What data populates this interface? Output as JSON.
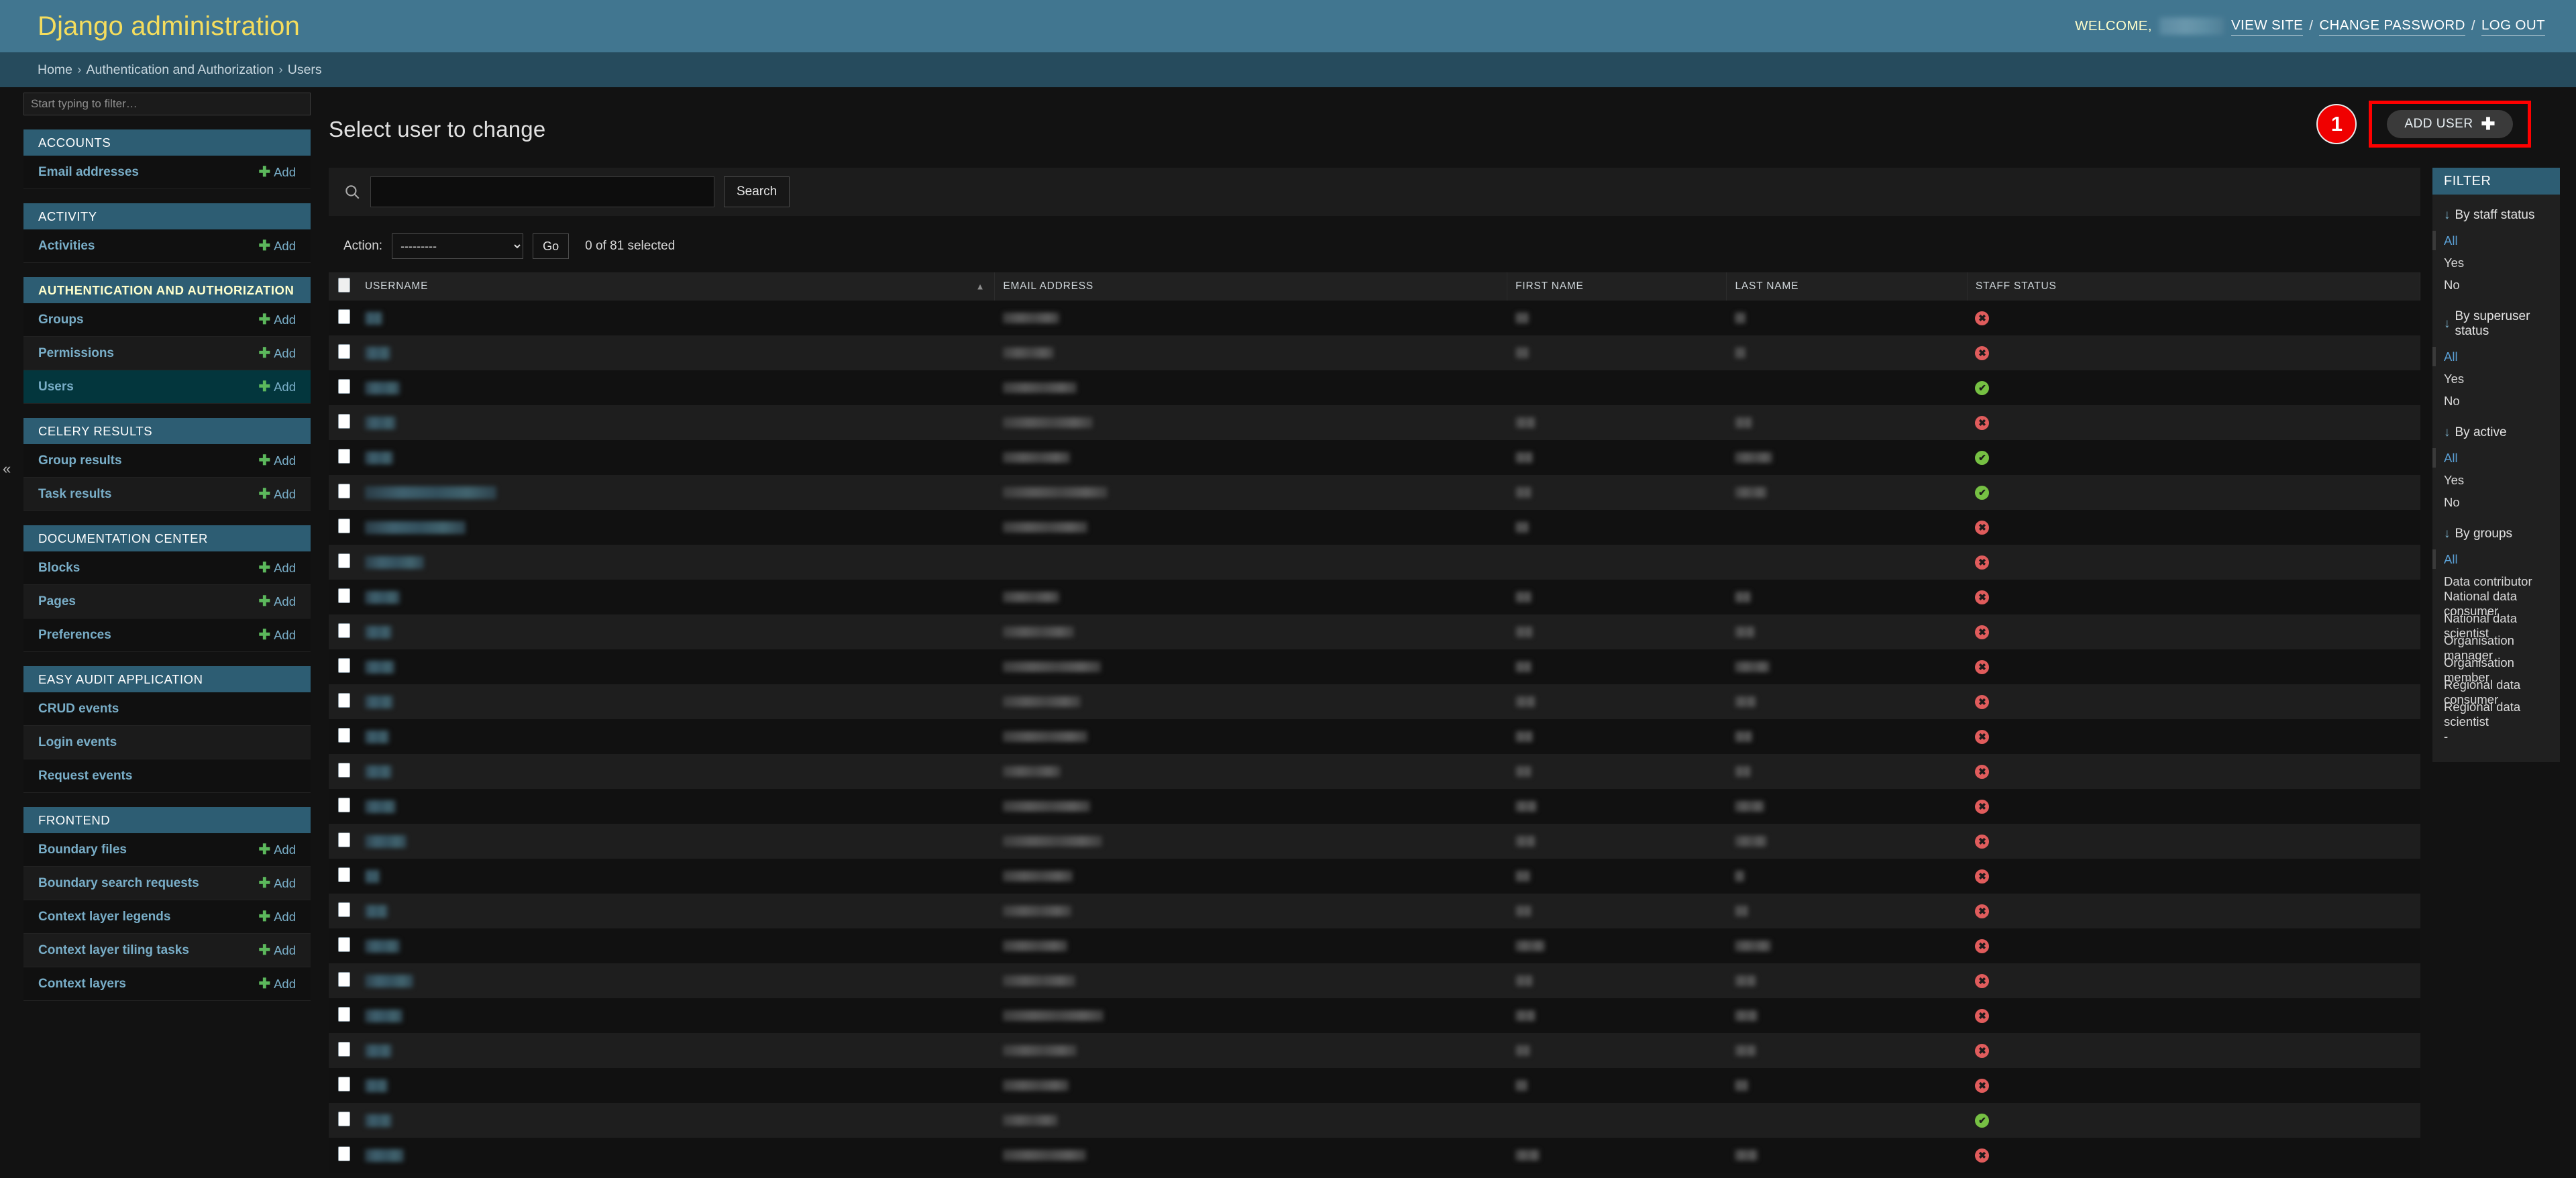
{
  "header": {
    "site_name": "Django administration",
    "welcome_label": "WELCOME,",
    "view_site": "VIEW SITE",
    "change_password": "CHANGE PASSWORD",
    "log_out": "LOG OUT",
    "separator": "/"
  },
  "breadcrumbs": {
    "home": "Home",
    "app": "Authentication and Authorization",
    "current": "Users",
    "separator": "›"
  },
  "nav_sidebar": {
    "filter_placeholder": "Start typing to filter…",
    "collapse_icon": "«",
    "add_label": "Add",
    "apps": [
      {
        "name": "ACCOUNTS",
        "current": false,
        "models": [
          {
            "label": "Email addresses",
            "add": true,
            "current": false
          }
        ]
      },
      {
        "name": "ACTIVITY",
        "current": false,
        "models": [
          {
            "label": "Activities",
            "add": true,
            "current": false
          }
        ]
      },
      {
        "name": "AUTHENTICATION AND AUTHORIZATION",
        "current": true,
        "models": [
          {
            "label": "Groups",
            "add": true,
            "current": false
          },
          {
            "label": "Permissions",
            "add": true,
            "current": false
          },
          {
            "label": "Users",
            "add": true,
            "current": true
          }
        ]
      },
      {
        "name": "CELERY RESULTS",
        "current": false,
        "models": [
          {
            "label": "Group results",
            "add": true,
            "current": false
          },
          {
            "label": "Task results",
            "add": true,
            "current": false
          }
        ]
      },
      {
        "name": "DOCUMENTATION CENTER",
        "current": false,
        "models": [
          {
            "label": "Blocks",
            "add": true,
            "current": false
          },
          {
            "label": "Pages",
            "add": true,
            "current": false
          },
          {
            "label": "Preferences",
            "add": true,
            "current": false
          }
        ]
      },
      {
        "name": "EASY AUDIT APPLICATION",
        "current": false,
        "models": [
          {
            "label": "CRUD events",
            "add": false,
            "current": false
          },
          {
            "label": "Login events",
            "add": false,
            "current": false
          },
          {
            "label": "Request events",
            "add": false,
            "current": false
          }
        ]
      },
      {
        "name": "FRONTEND",
        "current": false,
        "models": [
          {
            "label": "Boundary files",
            "add": true,
            "current": false
          },
          {
            "label": "Boundary search requests",
            "add": true,
            "current": false
          },
          {
            "label": "Context layer legends",
            "add": true,
            "current": false
          },
          {
            "label": "Context layer tiling tasks",
            "add": true,
            "current": false
          },
          {
            "label": "Context layers",
            "add": true,
            "current": false
          }
        ]
      }
    ]
  },
  "main": {
    "page_title": "Select user to change",
    "annotation_badge": "1",
    "add_button": "ADD USER",
    "add_button_plus": "✚",
    "search": {
      "value": "",
      "placeholder": "",
      "submit_label": "Search",
      "icon": "search-icon"
    },
    "actions": {
      "label": "Action:",
      "selected_option": "---------",
      "options": [
        "---------"
      ],
      "go_label": "Go",
      "counter": "0 of 81 selected"
    },
    "table": {
      "columns": [
        "USERNAME",
        "EMAIL ADDRESS",
        "FIRST NAME",
        "LAST NAME",
        "STAFF STATUS"
      ],
      "sorted_column": "USERNAME",
      "sort_direction": "asc",
      "sort_glyph": "▲",
      "rows": [
        {
          "username_w": 26,
          "email_w": 84,
          "first_w": 20,
          "last_w": 16,
          "staff": "no"
        },
        {
          "username_w": 38,
          "email_w": 76,
          "first_w": 20,
          "last_w": 16,
          "staff": "no"
        },
        {
          "username_w": 52,
          "email_w": 110,
          "first_w": 0,
          "last_w": 0,
          "staff": "yes"
        },
        {
          "username_w": 46,
          "email_w": 134,
          "first_w": 30,
          "last_w": 26,
          "staff": "no"
        },
        {
          "username_w": 42,
          "email_w": 100,
          "first_w": 26,
          "last_w": 56,
          "staff": "yes"
        },
        {
          "username_w": 196,
          "email_w": 156,
          "first_w": 24,
          "last_w": 48,
          "staff": "yes"
        },
        {
          "username_w": 150,
          "email_w": 126,
          "first_w": 20,
          "last_w": 0,
          "staff": "no"
        },
        {
          "username_w": 88,
          "email_w": 0,
          "first_w": 0,
          "last_w": 0,
          "staff": "no"
        },
        {
          "username_w": 52,
          "email_w": 84,
          "first_w": 24,
          "last_w": 24,
          "staff": "no"
        },
        {
          "username_w": 40,
          "email_w": 106,
          "first_w": 26,
          "last_w": 30,
          "staff": "no"
        },
        {
          "username_w": 44,
          "email_w": 146,
          "first_w": 24,
          "last_w": 52,
          "staff": "no"
        },
        {
          "username_w": 42,
          "email_w": 116,
          "first_w": 30,
          "last_w": 32,
          "staff": "no"
        },
        {
          "username_w": 36,
          "email_w": 126,
          "first_w": 26,
          "last_w": 26,
          "staff": "no"
        },
        {
          "username_w": 40,
          "email_w": 86,
          "first_w": 24,
          "last_w": 24,
          "staff": "no"
        },
        {
          "username_w": 46,
          "email_w": 130,
          "first_w": 32,
          "last_w": 44,
          "staff": "no"
        },
        {
          "username_w": 62,
          "email_w": 148,
          "first_w": 30,
          "last_w": 48,
          "staff": "no"
        },
        {
          "username_w": 22,
          "email_w": 104,
          "first_w": 22,
          "last_w": 14,
          "staff": "no"
        },
        {
          "username_w": 34,
          "email_w": 102,
          "first_w": 24,
          "last_w": 20,
          "staff": "no"
        },
        {
          "username_w": 52,
          "email_w": 96,
          "first_w": 44,
          "last_w": 54,
          "staff": "no"
        },
        {
          "username_w": 72,
          "email_w": 108,
          "first_w": 26,
          "last_w": 32,
          "staff": "no"
        },
        {
          "username_w": 56,
          "email_w": 150,
          "first_w": 30,
          "last_w": 34,
          "staff": "no"
        },
        {
          "username_w": 40,
          "email_w": 110,
          "first_w": 22,
          "last_w": 32,
          "staff": "no"
        },
        {
          "username_w": 34,
          "email_w": 98,
          "first_w": 18,
          "last_w": 20,
          "staff": "no"
        },
        {
          "username_w": 40,
          "email_w": 82,
          "first_w": 0,
          "last_w": 0,
          "staff": "yes"
        },
        {
          "username_w": 58,
          "email_w": 124,
          "first_w": 36,
          "last_w": 34,
          "staff": "no"
        }
      ]
    }
  },
  "filter_panel": {
    "title": "FILTER",
    "arrow_glyph": "↓",
    "groups": [
      {
        "title": "By staff status",
        "choices": [
          {
            "label": "All",
            "selected": true
          },
          {
            "label": "Yes",
            "selected": false
          },
          {
            "label": "No",
            "selected": false
          }
        ]
      },
      {
        "title": "By superuser status",
        "choices": [
          {
            "label": "All",
            "selected": true
          },
          {
            "label": "Yes",
            "selected": false
          },
          {
            "label": "No",
            "selected": false
          }
        ]
      },
      {
        "title": "By active",
        "choices": [
          {
            "label": "All",
            "selected": true
          },
          {
            "label": "Yes",
            "selected": false
          },
          {
            "label": "No",
            "selected": false
          }
        ]
      },
      {
        "title": "By groups",
        "choices": [
          {
            "label": "All",
            "selected": true
          },
          {
            "label": "Data contributor",
            "selected": false
          },
          {
            "label": "National data consumer",
            "selected": false
          },
          {
            "label": "National data scientist",
            "selected": false
          },
          {
            "label": "Organisation manager",
            "selected": false
          },
          {
            "label": "Organisation member",
            "selected": false
          },
          {
            "label": "Regional data consumer",
            "selected": false
          },
          {
            "label": "Regional data scientist",
            "selected": false
          },
          {
            "label": "-",
            "selected": false
          }
        ]
      }
    ]
  },
  "colors": {
    "brand_header": "#417690",
    "breadcrumb_bg": "#264b5d",
    "accent_link": "#79aec8",
    "accent_yellow": "#f5dd5d",
    "status_yes": "#76c043",
    "status_no": "#e05c5c",
    "annotation_red": "#f00000"
  }
}
